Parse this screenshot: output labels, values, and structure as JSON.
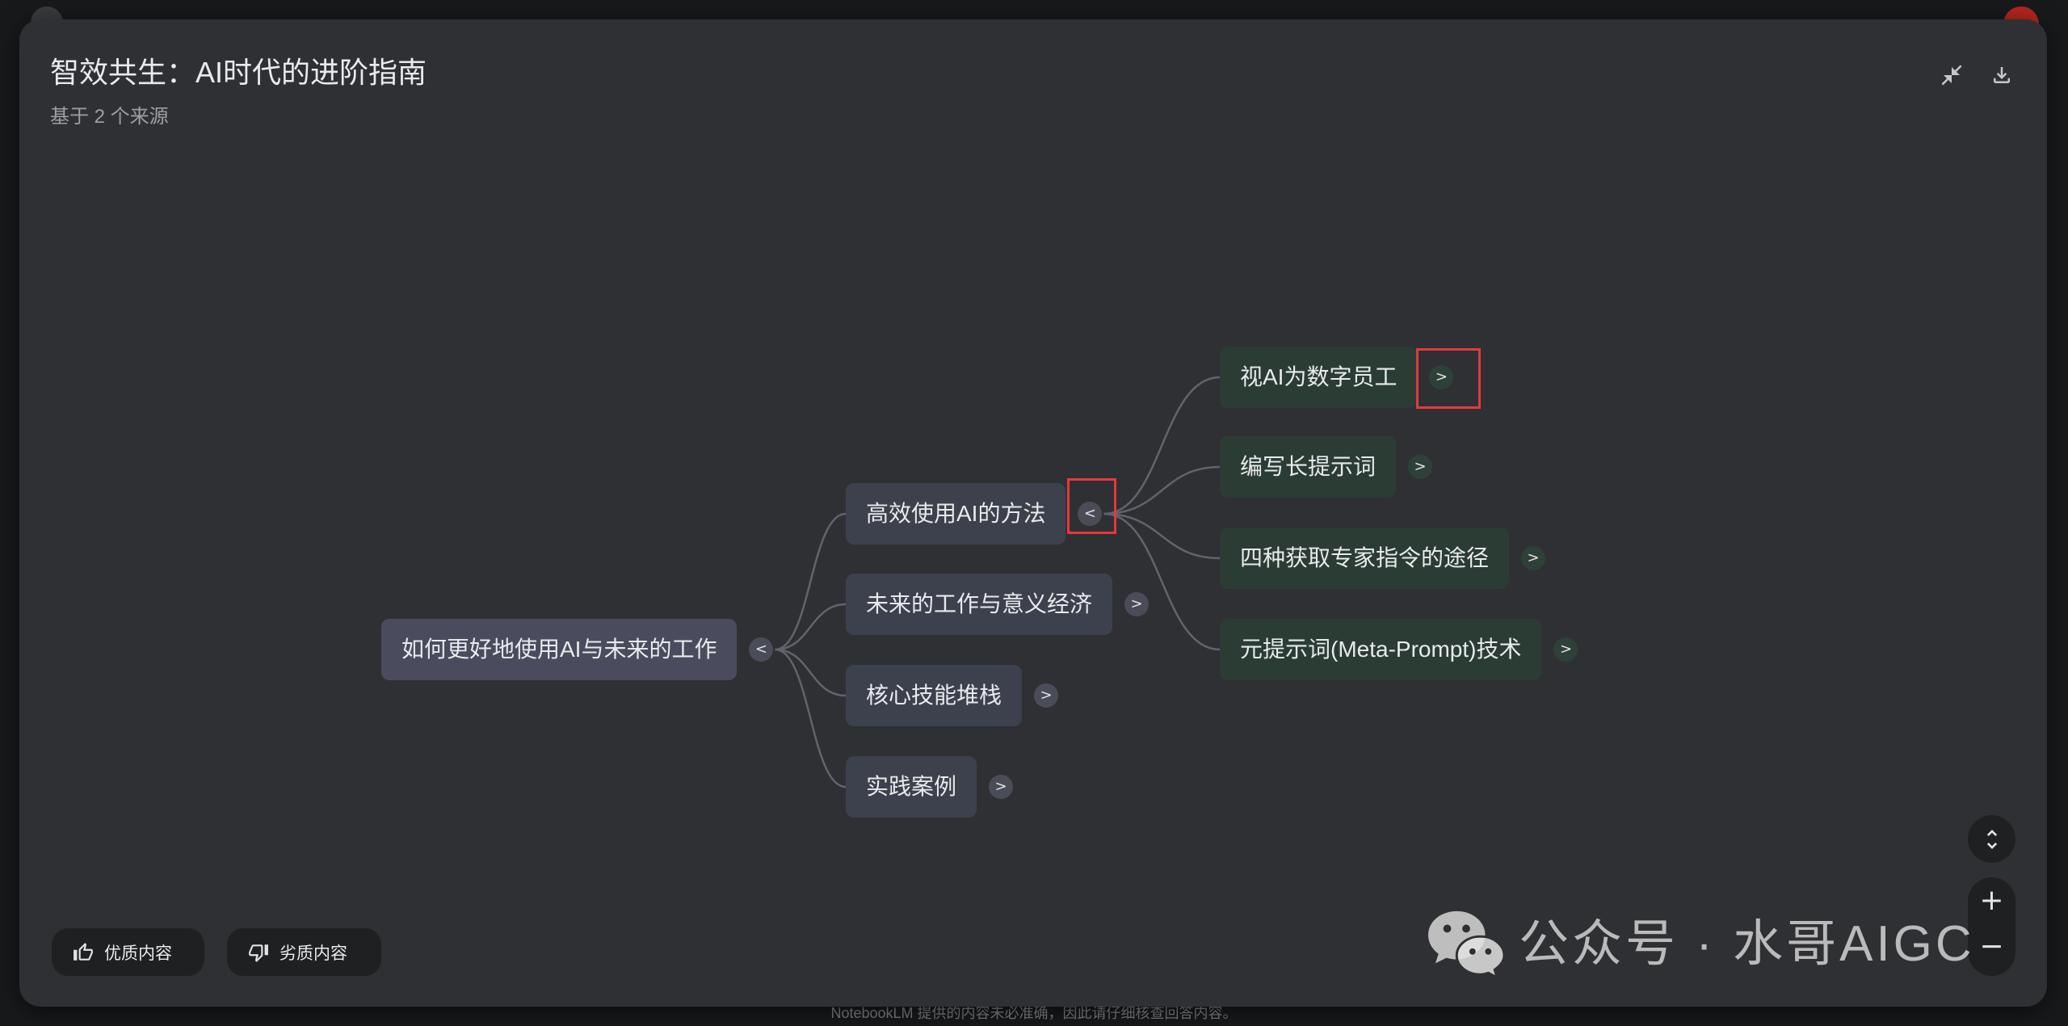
{
  "header": {
    "title": "智效共生：AI时代的进阶指南",
    "subtitle": "基于 2 个来源",
    "actions": [
      {
        "icon": "collapse-icon"
      },
      {
        "icon": "download-icon"
      }
    ]
  },
  "mindmap": {
    "root": {
      "label": "如何更好地使用AI与未来的工作",
      "toggle": "<"
    },
    "branches": [
      {
        "label": "高效使用AI的方法",
        "toggle": "<",
        "toggle_highlighted": true,
        "children": [
          {
            "label": "视AI为数字员工",
            "toggle": ">",
            "toggle_highlighted": true
          },
          {
            "label": "编写长提示词",
            "toggle": ">"
          },
          {
            "label": "四种获取专家指令的途径",
            "toggle": ">"
          },
          {
            "label": "元提示词(Meta-Prompt)技术",
            "toggle": ">"
          }
        ]
      },
      {
        "label": "未来的工作与意义经济",
        "toggle": ">"
      },
      {
        "label": "核心技能堆栈",
        "toggle": ">"
      },
      {
        "label": "实践案例",
        "toggle": ">"
      }
    ]
  },
  "feedback": {
    "good": {
      "label": "优质内容",
      "icon": "thumbs-up-icon"
    },
    "bad": {
      "label": "劣质内容",
      "icon": "thumbs-down-icon"
    }
  },
  "map_controls": {
    "expand_icon": "unfold-more-icon",
    "zoom_in": "+",
    "zoom_out": "−"
  },
  "watermark": {
    "icon": "wechat-icon",
    "text": "公众号 · 水哥AIGC"
  },
  "footer": {
    "disclaimer": "NotebookLM 提供的内容未必准确，因此请仔细核查回答内容。"
  },
  "colors": {
    "page_bg": "#18191b",
    "panel_bg": "#2f3034",
    "root_node": "#4a4c5e",
    "branch_node": "#3c414d",
    "leaf_node": "#2b3c35",
    "toggle_gray": "#4a4d57",
    "toggle_green": "#2e4139",
    "connector": "#60646d",
    "highlight": "#e3393d",
    "control_bg": "#1f2022"
  }
}
